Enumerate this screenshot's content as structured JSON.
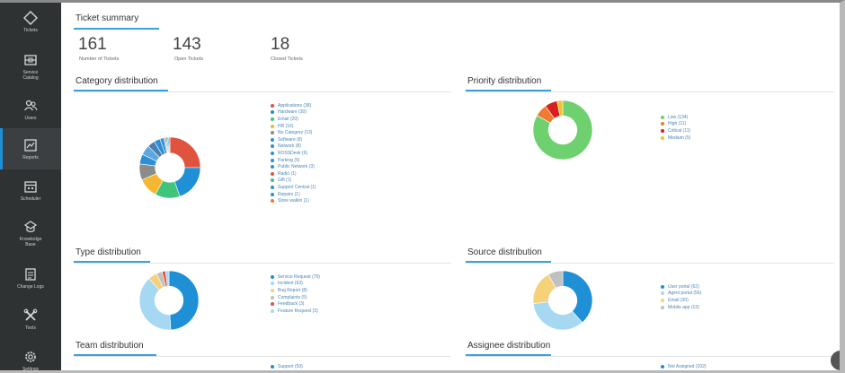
{
  "sidebar": {
    "items": [
      {
        "label": "Tickets",
        "icon": "tag-icon"
      },
      {
        "label": "Service\nCatalog",
        "icon": "catalog-icon"
      },
      {
        "label": "Users",
        "icon": "users-icon"
      },
      {
        "label": "Reports",
        "icon": "reports-icon",
        "active": true
      },
      {
        "label": "Scheduler",
        "icon": "calendar-icon"
      },
      {
        "label": "Knowledge\nBase",
        "icon": "knowledge-icon"
      },
      {
        "label": "Change Logs",
        "icon": "logs-icon"
      },
      {
        "label": "Tools",
        "icon": "tools-icon"
      },
      {
        "label": "Settings",
        "icon": "gear-icon"
      }
    ]
  },
  "summary": {
    "title": "Ticket summary",
    "stats": [
      {
        "value": "161",
        "label": "Number of Tickets"
      },
      {
        "value": "143",
        "label": "Open Tickets"
      },
      {
        "value": "18",
        "label": "Closed Tickets"
      }
    ]
  },
  "sections": {
    "category": {
      "title": "Category distribution"
    },
    "priority": {
      "title": "Priority distribution"
    },
    "type": {
      "title": "Type distribution"
    },
    "source": {
      "title": "Source distribution"
    },
    "team": {
      "title": "Team distribution"
    },
    "assignee": {
      "title": "Assignee distribution"
    }
  },
  "legends": {
    "category": [
      {
        "label": "Applications (38)",
        "color": "#e0533f"
      },
      {
        "label": "Hardware (30)",
        "color": "#1f8fd6"
      },
      {
        "label": "Email (20)",
        "color": "#3fc47a"
      },
      {
        "label": "HR (16)",
        "color": "#f5b72f"
      },
      {
        "label": "No Category (13)",
        "color": "#8b8b8b"
      },
      {
        "label": "Software (8)",
        "color": "#2d8fd5"
      },
      {
        "label": "Network (8)",
        "color": "#2d8fd5"
      },
      {
        "label": "ROSSDesk (6)",
        "color": "#2d8fd5"
      },
      {
        "label": "Parking (5)",
        "color": "#2d8fd5"
      },
      {
        "label": "Public Network (3)",
        "color": "#2d8fd5"
      },
      {
        "label": "Radio (1)",
        "color": "#e0533f"
      },
      {
        "label": "Gift (1)",
        "color": "#3fc47a"
      },
      {
        "label": "Support Central (1)",
        "color": "#2d8fd5"
      },
      {
        "label": "Repairs (1)",
        "color": "#2d8fd5"
      },
      {
        "label": "Store walkin (1)",
        "color": "#f07a2f"
      }
    ],
    "priority": [
      {
        "label": "Low (134)",
        "color": "#6fd06f"
      },
      {
        "label": "High (11)",
        "color": "#f07a2f"
      },
      {
        "label": "Critical (11)",
        "color": "#d91e1e"
      },
      {
        "label": "Medium (5)",
        "color": "#f5c02f"
      }
    ],
    "type": [
      {
        "label": "Service Request (79)",
        "color": "#1f8fd6"
      },
      {
        "label": "Incident (63)",
        "color": "#a6d8f2"
      },
      {
        "label": "Bug Report (8)",
        "color": "#f5d27a"
      },
      {
        "label": "Complaints (5)",
        "color": "#c0c0c0"
      },
      {
        "label": "Feedback (3)",
        "color": "#e0533f"
      },
      {
        "label": "Feature Request (3)",
        "color": "#a6d8f2"
      }
    ],
    "source": [
      {
        "label": "User portal (62)",
        "color": "#1f8fd6"
      },
      {
        "label": "Agent portal (56)",
        "color": "#a6d8f2"
      },
      {
        "label": "Email (30)",
        "color": "#f5d27a"
      },
      {
        "label": "Mobile app (13)",
        "color": "#c0c0c0"
      }
    ],
    "team": [
      {
        "label": "Support (53)",
        "color": "#1f8fd6"
      }
    ],
    "assignee": [
      {
        "label": "Not Assigned (102)",
        "color": "#1f8fd6"
      }
    ]
  },
  "chart_data": [
    {
      "type": "pie",
      "title": "Category distribution",
      "labels": [
        "Applications",
        "Hardware",
        "Email",
        "HR",
        "No Category",
        "Software",
        "Network",
        "ROSSDesk",
        "Parking",
        "Public Network",
        "Radio",
        "Gift",
        "Support Central",
        "Repairs",
        "Store walkin"
      ],
      "values": [
        38,
        30,
        20,
        16,
        13,
        8,
        8,
        6,
        5,
        3,
        1,
        1,
        1,
        1,
        1
      ],
      "colors": [
        "#e0533f",
        "#1f8fd6",
        "#3fc47a",
        "#f5b72f",
        "#8b8b8b",
        "#2d8fd5",
        "#5ea8e0",
        "#4a7fb0",
        "#2d8fd5",
        "#2d8fd5",
        "#e0533f",
        "#3fc47a",
        "#2d8fd5",
        "#2d8fd5",
        "#f07a2f"
      ]
    },
    {
      "type": "pie",
      "title": "Priority distribution",
      "labels": [
        "Low",
        "High",
        "Critical",
        "Medium"
      ],
      "values": [
        134,
        11,
        11,
        5
      ],
      "colors": [
        "#6fd06f",
        "#f07a2f",
        "#d91e1e",
        "#f5c02f"
      ]
    },
    {
      "type": "pie",
      "title": "Type distribution",
      "labels": [
        "Service Request",
        "Incident",
        "Bug Report",
        "Complaints",
        "Feedback",
        "Feature Request"
      ],
      "values": [
        79,
        63,
        8,
        5,
        3,
        3
      ],
      "colors": [
        "#1f8fd6",
        "#a6d8f2",
        "#f5d27a",
        "#c0c0c0",
        "#e0533f",
        "#a6d8f2"
      ]
    },
    {
      "type": "pie",
      "title": "Source distribution",
      "labels": [
        "User portal",
        "Agent portal",
        "Email",
        "Mobile app"
      ],
      "values": [
        62,
        56,
        30,
        13
      ],
      "colors": [
        "#1f8fd6",
        "#a6d8f2",
        "#f5d27a",
        "#c0c0c0"
      ]
    }
  ]
}
